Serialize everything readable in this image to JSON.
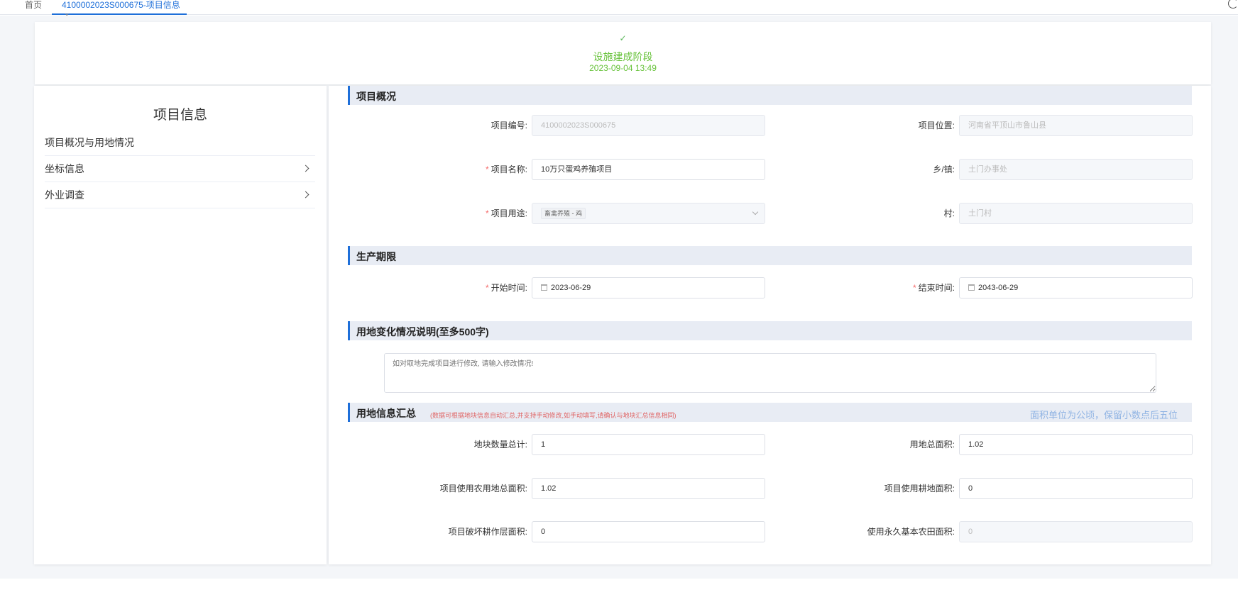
{
  "tabs": {
    "home_label": "首页",
    "active_label": "4100002023S000675-项目信息",
    "close_glyph": "×"
  },
  "status": {
    "check_glyph": "✓",
    "stage_name": "设施建成阶段",
    "timestamp": "2023-09-04 13:49"
  },
  "sidebar": {
    "title": "项目信息",
    "items": [
      {
        "label": "项目概况与用地情况"
      },
      {
        "label": "坐标信息"
      },
      {
        "label": "外业调查"
      }
    ]
  },
  "sections": {
    "overview": {
      "title": "项目概况",
      "fields": {
        "project_code": {
          "label": "项目编号:",
          "value": "4100002023S000675"
        },
        "project_location": {
          "label": "项目位置:",
          "value": "河南省平顶山市鲁山县"
        },
        "project_name": {
          "label": "项目名称:",
          "value": "10万只蛋鸡养殖项目",
          "required": "*"
        },
        "township": {
          "label": "乡/镇:",
          "value": "土门办事处"
        },
        "project_use": {
          "label": "项目用途:",
          "value": "畜禽养殖 - 鸡",
          "required": "*"
        },
        "village": {
          "label": "村:",
          "value": "土门村"
        }
      }
    },
    "production_period": {
      "title": "生产期限",
      "fields": {
        "start_date": {
          "label": "开始时间:",
          "value": "2023-06-29",
          "required": "*"
        },
        "end_date": {
          "label": "结束时间:",
          "value": "2043-06-29",
          "required": "*"
        }
      }
    },
    "land_change": {
      "title": "用地变化情况说明(至多500字)",
      "placeholder": "如对取地完成项目进行修改, 请输入修改情况!"
    },
    "land_summary": {
      "title": "用地信息汇总",
      "note": "(数据可根据地块信息自动汇总,并支持手动修改,如手动填写,请确认与地块汇总信息相同)",
      "unit_note": "面积单位为公顷，保留小数点后五位",
      "fields": {
        "parcel_count": {
          "label": "地块数量总计:",
          "value": "1"
        },
        "total_area": {
          "label": "用地总面积:",
          "value": "1.02"
        },
        "agri_land_area": {
          "label": "项目使用农用地总面积:",
          "value": "1.02"
        },
        "arable_land_area": {
          "label": "项目使用耕地面积:",
          "value": "0"
        },
        "damaged_plough_area": {
          "label": "项目破坏耕作层面积:",
          "value": "0"
        },
        "basic_farmland_area": {
          "label": "使用永久基本农田面积:",
          "value": "0"
        }
      }
    }
  }
}
